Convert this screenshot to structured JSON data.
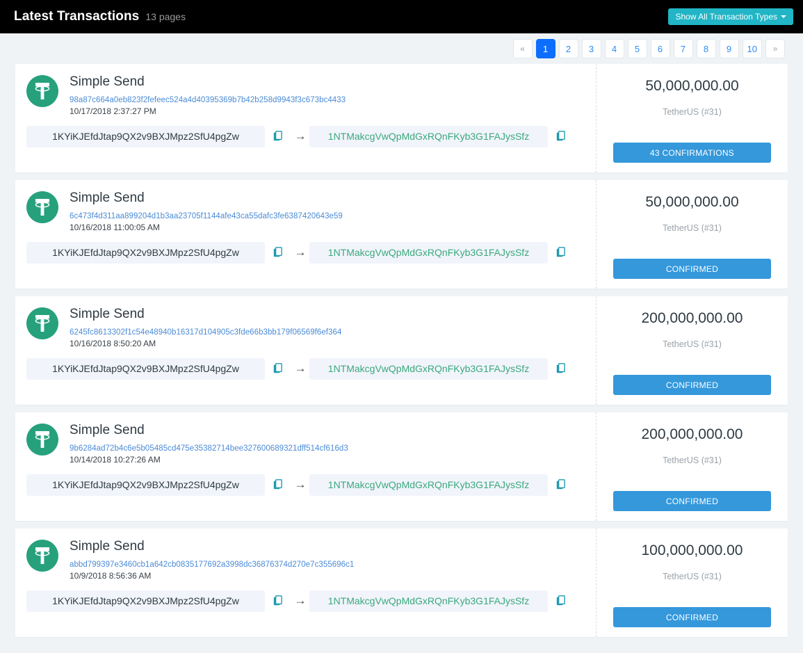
{
  "header": {
    "title": "Latest Transactions",
    "subtitle": "13 pages",
    "filter_button": "Show All Transaction Types",
    "filter_caret_icon": "chevron-down-icon",
    "background": "#000000",
    "filter_color": "#21b5c6"
  },
  "pagination": {
    "prev_label": "«",
    "next_label": "»",
    "active_page": "1",
    "pages": [
      "1",
      "2",
      "3",
      "4",
      "5",
      "6",
      "7",
      "8",
      "9",
      "10"
    ],
    "active_color": "#0d6efd",
    "link_color": "#2d8cf5"
  },
  "icons": {
    "token": "tether-logo-icon",
    "copy": "copy-icon",
    "arrow": "arrow-right-icon"
  },
  "colors": {
    "page_background": "#f0f3f5",
    "card_background": "#ffffff",
    "tether_green": "#26a17b",
    "address_to": "#3aa87c",
    "hash_link": "#4b8bd6",
    "status_blue": "#3498db"
  },
  "transactions": [
    {
      "type": "Simple Send",
      "hash": "98a87c664a0eb823f2fefeec524a4d40395369b7b42b258d9943f3c673bc4433",
      "date": "10/17/2018 2:37:27 PM",
      "from": "1KYiKJEfdJtap9QX2v9BXJMpz2SfU4pgZw",
      "to": "1NTMakcgVwQpMdGxRQnFKyb3G1FAJysSfz",
      "amount": "50,000,000.00",
      "token": "TetherUS (#31)",
      "status": "43 CONFIRMATIONS"
    },
    {
      "type": "Simple Send",
      "hash": "6c473f4d311aa899204d1b3aa23705f1144afe43ca55dafc3fe6387420643e59",
      "date": "10/16/2018 11:00:05 AM",
      "from": "1KYiKJEfdJtap9QX2v9BXJMpz2SfU4pgZw",
      "to": "1NTMakcgVwQpMdGxRQnFKyb3G1FAJysSfz",
      "amount": "50,000,000.00",
      "token": "TetherUS (#31)",
      "status": "CONFIRMED"
    },
    {
      "type": "Simple Send",
      "hash": "6245fc8613302f1c54e48940b16317d104905c3fde66b3bb179f06569f6ef364",
      "date": "10/16/2018 8:50:20 AM",
      "from": "1KYiKJEfdJtap9QX2v9BXJMpz2SfU4pgZw",
      "to": "1NTMakcgVwQpMdGxRQnFKyb3G1FAJysSfz",
      "amount": "200,000,000.00",
      "token": "TetherUS (#31)",
      "status": "CONFIRMED"
    },
    {
      "type": "Simple Send",
      "hash": "9b6284ad72b4c6e5b05485cd475e35382714bee327600689321dff514cf616d3",
      "date": "10/14/2018 10:27:26 AM",
      "from": "1KYiKJEfdJtap9QX2v9BXJMpz2SfU4pgZw",
      "to": "1NTMakcgVwQpMdGxRQnFKyb3G1FAJysSfz",
      "amount": "200,000,000.00",
      "token": "TetherUS (#31)",
      "status": "CONFIRMED"
    },
    {
      "type": "Simple Send",
      "hash": "abbd799397e3460cb1a642cb0835177692a3998dc36876374d270e7c355696c1",
      "date": "10/9/2018 8:56:36 AM",
      "from": "1KYiKJEfdJtap9QX2v9BXJMpz2SfU4pgZw",
      "to": "1NTMakcgVwQpMdGxRQnFKyb3G1FAJysSfz",
      "amount": "100,000,000.00",
      "token": "TetherUS (#31)",
      "status": "CONFIRMED"
    }
  ]
}
